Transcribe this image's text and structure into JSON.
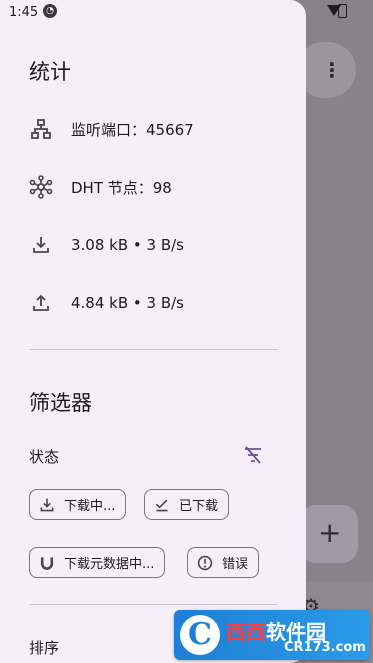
{
  "status_bar": {
    "time": "1:45"
  },
  "drawer": {
    "stats_title": "统计",
    "stats": [
      {
        "icon": "network-icon",
        "text": "监听端口：45667"
      },
      {
        "icon": "dht-hub-icon",
        "text": "DHT 节点：98"
      },
      {
        "icon": "download-icon",
        "text": "3.08 kB • 3 B/s"
      },
      {
        "icon": "upload-icon",
        "text": "4.84 kB • 3 B/s"
      }
    ],
    "filters_title": "筛选器",
    "status_label": "状态",
    "chips": {
      "downloading": "下载中...",
      "downloaded": "已下载",
      "metadata": "下载元数据中...",
      "error": "错误"
    },
    "sort_label": "排序"
  },
  "watermark": {
    "brand": "西西",
    "suffix": "软件园",
    "sub": "CR173.com"
  }
}
